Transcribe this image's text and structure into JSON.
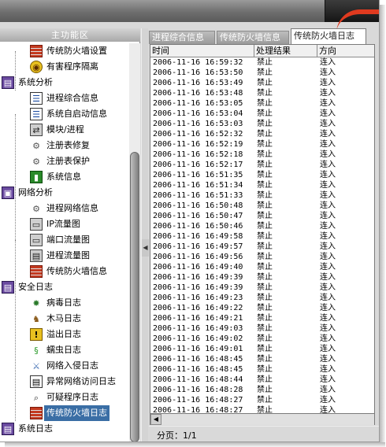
{
  "left_panel": {
    "header": "主功能区",
    "tree": [
      {
        "kind": "child",
        "icon": "firewall-icon",
        "glyph": "",
        "label": "传统防火墙设置"
      },
      {
        "kind": "child",
        "icon": "quarantine-icon",
        "glyph": "◉",
        "label": "有害程序隔离"
      },
      {
        "kind": "category",
        "icon": "system-analysis-icon",
        "glyph": "▤",
        "label": "系统分析"
      },
      {
        "kind": "child",
        "icon": "process-info-icon",
        "glyph": "☰",
        "label": "进程综合信息"
      },
      {
        "kind": "child",
        "icon": "autostart-icon",
        "glyph": "☰",
        "label": "系统自启动信息"
      },
      {
        "kind": "child",
        "icon": "module-process-icon",
        "glyph": "⇄",
        "label": "模块/进程"
      },
      {
        "kind": "child",
        "icon": "registry-repair-icon",
        "glyph": "⚙",
        "label": "注册表修复"
      },
      {
        "kind": "child",
        "icon": "registry-protect-icon",
        "glyph": "⚙",
        "label": "注册表保护"
      },
      {
        "kind": "child",
        "icon": "system-info-icon",
        "glyph": "▮",
        "label": "系统信息"
      },
      {
        "kind": "category",
        "icon": "network-analysis-icon",
        "glyph": "▣",
        "label": "网络分析"
      },
      {
        "kind": "child",
        "icon": "process-network-icon",
        "glyph": "⚙",
        "label": "进程网络信息"
      },
      {
        "kind": "child",
        "icon": "ip-traffic-icon",
        "glyph": "▭",
        "label": "IP流量图"
      },
      {
        "kind": "child",
        "icon": "port-traffic-icon",
        "glyph": "▭",
        "label": "端口流量图"
      },
      {
        "kind": "child",
        "icon": "process-traffic-icon",
        "glyph": "▤",
        "label": "进程流量图"
      },
      {
        "kind": "child",
        "icon": "firewall-info-icon",
        "glyph": "",
        "label": "传统防火墙信息"
      },
      {
        "kind": "category",
        "icon": "security-log-icon",
        "glyph": "▤",
        "label": "安全日志"
      },
      {
        "kind": "child",
        "icon": "virus-icon",
        "glyph": "✸",
        "label": "病毒日志"
      },
      {
        "kind": "child",
        "icon": "trojan-horse-icon",
        "glyph": "♞",
        "label": "木马日志"
      },
      {
        "kind": "child",
        "icon": "overflow-warning-icon",
        "glyph": "!",
        "label": "溢出日志"
      },
      {
        "kind": "child",
        "icon": "worm-icon",
        "glyph": "§",
        "label": "蠕虫日志"
      },
      {
        "kind": "child",
        "icon": "intrusion-sword-icon",
        "glyph": "⚔",
        "label": "网络入侵日志"
      },
      {
        "kind": "child",
        "icon": "abnormal-access-icon",
        "glyph": "▤",
        "label": "异常网络访问日志"
      },
      {
        "kind": "child",
        "icon": "suspicious-program-icon",
        "glyph": "⌕",
        "label": "可疑程序日志"
      },
      {
        "kind": "child",
        "icon": "firewall-log-icon",
        "glyph": "",
        "label": "传统防火墙日志",
        "selected": true
      },
      {
        "kind": "category",
        "icon": "system-log-icon",
        "glyph": "▤",
        "label": "系统日志"
      }
    ]
  },
  "tabs": [
    {
      "label": "进程综合信息",
      "active": false
    },
    {
      "label": "传统防火墙信息",
      "active": false
    },
    {
      "label": "传统防火墙日志",
      "active": true
    }
  ],
  "log_table": {
    "columns": [
      "时间",
      "处理结果",
      "方向"
    ],
    "rows": [
      [
        "2006-11-16  16:59:32",
        "禁止",
        "连入"
      ],
      [
        "2006-11-16  16:53:50",
        "禁止",
        "连入"
      ],
      [
        "2006-11-16  16:53:49",
        "禁止",
        "连入"
      ],
      [
        "2006-11-16  16:53:48",
        "禁止",
        "连入"
      ],
      [
        "2006-11-16  16:53:05",
        "禁止",
        "连入"
      ],
      [
        "2006-11-16  16:53:04",
        "禁止",
        "连入"
      ],
      [
        "2006-11-16  16:53:03",
        "禁止",
        "连入"
      ],
      [
        "2006-11-16  16:52:32",
        "禁止",
        "连入"
      ],
      [
        "2006-11-16  16:52:19",
        "禁止",
        "连入"
      ],
      [
        "2006-11-16  16:52:18",
        "禁止",
        "连入"
      ],
      [
        "2006-11-16  16:52:17",
        "禁止",
        "连入"
      ],
      [
        "2006-11-16  16:51:35",
        "禁止",
        "连入"
      ],
      [
        "2006-11-16  16:51:34",
        "禁止",
        "连入"
      ],
      [
        "2006-11-16  16:51:33",
        "禁止",
        "连入"
      ],
      [
        "2006-11-16  16:50:48",
        "禁止",
        "连入"
      ],
      [
        "2006-11-16  16:50:47",
        "禁止",
        "连入"
      ],
      [
        "2006-11-16  16:50:46",
        "禁止",
        "连入"
      ],
      [
        "2006-11-16  16:49:58",
        "禁止",
        "连入"
      ],
      [
        "2006-11-16  16:49:57",
        "禁止",
        "连入"
      ],
      [
        "2006-11-16  16:49:56",
        "禁止",
        "连入"
      ],
      [
        "2006-11-16  16:49:40",
        "禁止",
        "连入"
      ],
      [
        "2006-11-16  16:49:39",
        "禁止",
        "连入"
      ],
      [
        "2006-11-16  16:49:39",
        "禁止",
        "连入"
      ],
      [
        "2006-11-16  16:49:23",
        "禁止",
        "连入"
      ],
      [
        "2006-11-16  16:49:22",
        "禁止",
        "连入"
      ],
      [
        "2006-11-16  16:49:21",
        "禁止",
        "连入"
      ],
      [
        "2006-11-16  16:49:03",
        "禁止",
        "连入"
      ],
      [
        "2006-11-16  16:49:02",
        "禁止",
        "连入"
      ],
      [
        "2006-11-16  16:49:01",
        "禁止",
        "连入"
      ],
      [
        "2006-11-16  16:48:45",
        "禁止",
        "连入"
      ],
      [
        "2006-11-16  16:48:45",
        "禁止",
        "连入"
      ],
      [
        "2006-11-16  16:48:44",
        "禁止",
        "连入"
      ],
      [
        "2006-11-16  16:48:28",
        "禁止",
        "连入"
      ],
      [
        "2006-11-16  16:48:27",
        "禁止",
        "连入"
      ],
      [
        "2006-11-16  16:48:27",
        "禁止",
        "连入"
      ]
    ]
  },
  "status": {
    "pager_label": "分页：",
    "pager_value": "1/1"
  },
  "colors": {
    "selection": "#3a6ea5",
    "title_accent": "#e03a1f",
    "window_bg": "#d9d9d9"
  }
}
